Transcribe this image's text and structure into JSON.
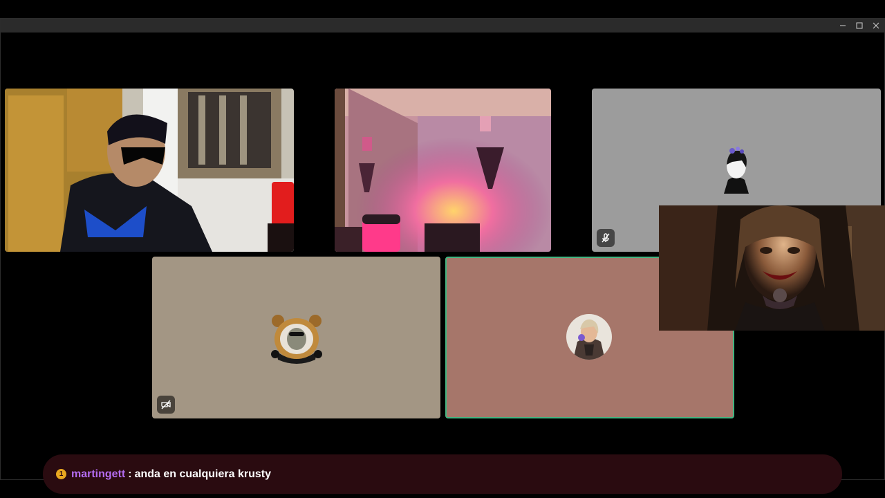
{
  "window": {
    "controls": [
      "minimize-icon",
      "maximize-icon",
      "close-icon"
    ]
  },
  "tiles": [
    {
      "id": "video-person-mask",
      "kind": "video"
    },
    {
      "id": "video-pink-room",
      "kind": "video"
    },
    {
      "id": "avatar-anime-boy",
      "kind": "avatar",
      "bg": "#9c9c9c",
      "badge": "mic-muted-icon"
    },
    {
      "id": "avatar-bear-costume",
      "kind": "avatar",
      "bg": "#a39684",
      "badge": "camera-off-icon"
    },
    {
      "id": "avatar-portrait",
      "kind": "avatar",
      "bg": "#a6766a",
      "speaking": true,
      "speaking_color": "#43b581"
    }
  ],
  "overlay": {
    "id": "webcam-overlay-horror-character"
  },
  "chat": {
    "badge": "1",
    "username": "martingett",
    "separator": ":",
    "message": "anda en cualquiera krusty",
    "username_color": "#b36cf0",
    "bar_color": "#2a0b10"
  }
}
